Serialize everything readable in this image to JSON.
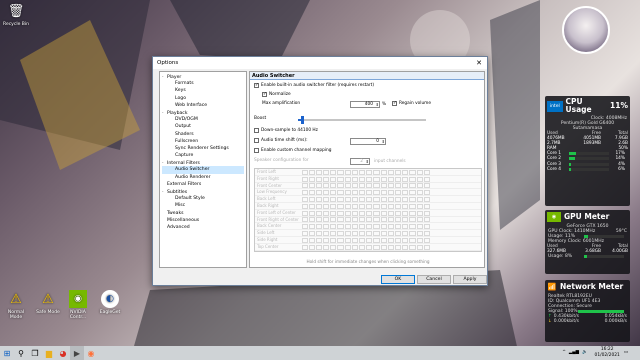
{
  "desktop": {
    "icons_top": [
      {
        "label": "Recycle Bin",
        "icon": "recycle-bin-icon"
      }
    ],
    "icons_bottom": [
      {
        "label": "Normal Mode",
        "icon": "warning-icon"
      },
      {
        "label": "Safe Mode",
        "icon": "warning-icon"
      },
      {
        "label": "NVIDIA Contr...",
        "icon": "nvidia-icon"
      },
      {
        "label": "EagleGet",
        "icon": "eagleget-icon"
      }
    ]
  },
  "dialog": {
    "title": "Options",
    "close": "✕",
    "tree": [
      {
        "label": "Player",
        "level": 0,
        "toggle": "-"
      },
      {
        "label": "Formats",
        "level": 1
      },
      {
        "label": "Keys",
        "level": 1
      },
      {
        "label": "Logo",
        "level": 1
      },
      {
        "label": "Web Interface",
        "level": 1
      },
      {
        "label": "Playback",
        "level": 0,
        "toggle": "-"
      },
      {
        "label": "DVD/OGM",
        "level": 1
      },
      {
        "label": "Output",
        "level": 1
      },
      {
        "label": "Shaders",
        "level": 1
      },
      {
        "label": "Fullscreen",
        "level": 1
      },
      {
        "label": "Sync Renderer Settings",
        "level": 1
      },
      {
        "label": "Capture",
        "level": 1
      },
      {
        "label": "Internal Filters",
        "level": 0,
        "toggle": "-"
      },
      {
        "label": "Audio Switcher",
        "level": 1,
        "selected": true
      },
      {
        "label": "Audio Renderer",
        "level": 1
      },
      {
        "label": "External Filters",
        "level": 0
      },
      {
        "label": "Subtitles",
        "level": 0,
        "toggle": "-"
      },
      {
        "label": "Default Style",
        "level": 1
      },
      {
        "label": "Misc",
        "level": 1
      },
      {
        "label": "Tweaks",
        "level": 0
      },
      {
        "label": "Miscellaneous",
        "level": 0
      },
      {
        "label": "Advanced",
        "level": 0
      }
    ],
    "panel": {
      "title": "Audio Switcher",
      "enable_builtin": "Enable built-in audio switcher filter (requires restart)",
      "normalize": "Normalize",
      "max_amp_label": "Max amplification",
      "max_amp_value": "400",
      "max_amp_unit": "%",
      "regain_volume": "Regain volume",
      "boost_label": "Boost",
      "boost_level": 0.02,
      "downsample": "Down-sample to 44100 Hz",
      "time_shift": "Audio time shift (ms):",
      "time_shift_value": "0",
      "custom_mapping": "Enable custom channel mapping",
      "speaker_config": "Speaker configuration for",
      "speaker_value": "2",
      "input_channels": "input channels",
      "matrix_rows": [
        "Front Left",
        "Front Right",
        "Front Center",
        "Low Frequency",
        "Back Left",
        "Back Right",
        "Front Left of Center",
        "Front Right of Center",
        "Back Center",
        "Side Left",
        "Side Right",
        "Top Center"
      ],
      "hint": "Hold shift for immediate changes when clicking something"
    },
    "buttons": {
      "ok": "OK",
      "cancel": "Cancel",
      "apply": "Apply"
    }
  },
  "cpu": {
    "title": "CPU Usage",
    "usage": "11%",
    "clock": "Clock: 4008MHz",
    "model": "Pentium(R) Gold G6400",
    "host": "Sutamamasa",
    "headers": [
      "Used",
      "Free",
      "Total"
    ],
    "rows": [
      [
        "4076MB",
        "4051MB",
        "7.9GB"
      ],
      [
        "2.7MB",
        "1893MB",
        "2.6B"
      ],
      [
        "RAM",
        "",
        "50%"
      ]
    ],
    "cores": [
      {
        "label": "Core 1",
        "pct": "17%",
        "value": 17
      },
      {
        "label": "Core 2",
        "pct": "14%",
        "value": 14
      },
      {
        "label": "Core 3",
        "pct": "4%",
        "value": 4
      },
      {
        "label": "Core 4",
        "pct": "6%",
        "value": 6
      }
    ]
  },
  "gpu": {
    "title": "GPU Meter",
    "model": "GeForce GTX 1650",
    "clock": "GPU Clock: 1410MHz",
    "temp": "59°C",
    "usage": "Usage: 11%",
    "usage_value": 11,
    "mem_clock": "Memory Clock: 6001MHz",
    "headers": [
      "Used",
      "Free",
      "Total"
    ],
    "row": [
      "327.6MB",
      "3.68GB",
      "4.00GB"
    ],
    "mem_usage": "Usage: 8%",
    "mem_usage_value": 8
  },
  "network": {
    "title": "Network Meter",
    "adapter": "Realtek RTL8192EU",
    "id": "ID: Qualcomm UF1 4E3",
    "connection": "Connection: Secure",
    "signal": "Signal: 100%",
    "signal_value": 100,
    "up": "0.430kbit/s",
    "up2": "0.054kB/s",
    "down": "0.000kbit/s",
    "down2": "0.000kB/s"
  },
  "taskbar": {
    "time": "16:22",
    "date": "01/02/2021",
    "colors": {
      "bg": "#cfd3d6"
    }
  }
}
